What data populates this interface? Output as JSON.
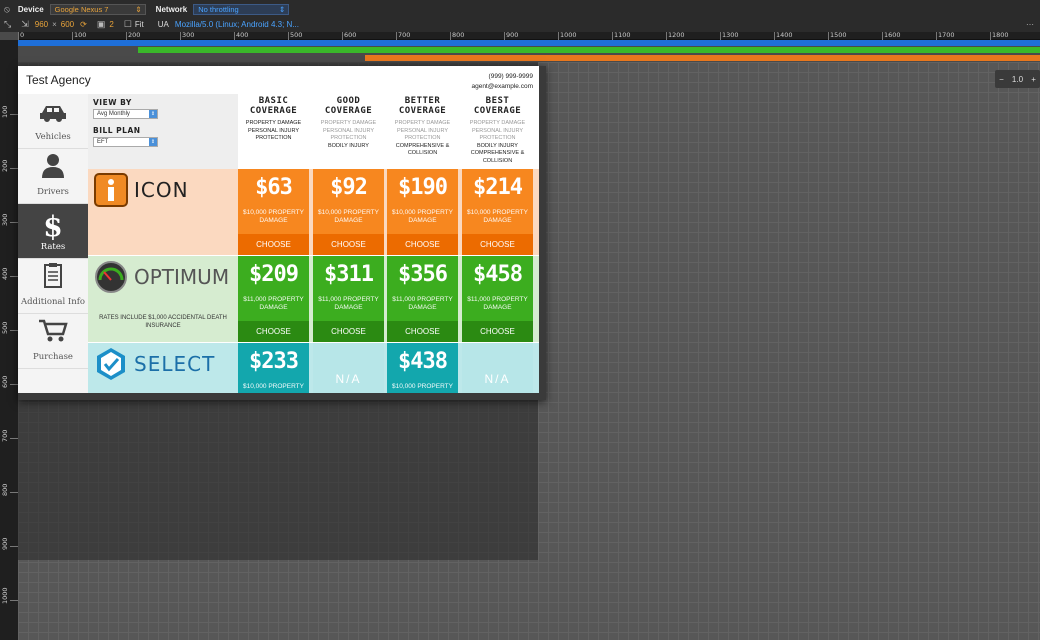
{
  "devtools": {
    "device_label": "Device",
    "device_value": "Google Nexus 7",
    "network_label": "Network",
    "network_value": "No throttling",
    "width": "960",
    "times": "×",
    "height": "600",
    "dpr": "2",
    "fit_label": "Fit",
    "ua_label": "UA",
    "ua_value": "Mozilla/5.0 (Linux; Android 4.3; N...",
    "zoom_value": "1.0",
    "zoom_minus": "−",
    "zoom_plus": "+",
    "ruler_h": [
      "0",
      "100",
      "200",
      "300",
      "400",
      "500",
      "600",
      "700",
      "800",
      "900",
      "1000",
      "1100",
      "1200",
      "1300",
      "1400",
      "1500",
      "1600",
      "1700",
      "1800"
    ],
    "ruler_v": [
      "100",
      "200",
      "300",
      "400",
      "500",
      "600",
      "700",
      "800",
      "900",
      "1000"
    ]
  },
  "app": {
    "agency_name": "Test Agency",
    "phone": "(999) 999-9999",
    "email": "agent@example.com",
    "nav": [
      {
        "label": "Vehicles",
        "icon": "car-icon"
      },
      {
        "label": "Drivers",
        "icon": "person-icon"
      },
      {
        "label": "Rates",
        "icon": "dollar-icon"
      },
      {
        "label": "Additional Info",
        "icon": "clipboard-icon"
      },
      {
        "label": "Purchase",
        "icon": "cart-icon"
      }
    ],
    "controls": {
      "view_by_label": "VIEW BY",
      "view_by_value": "Avg Monthly",
      "bill_plan_label": "BILL PLAN",
      "bill_plan_value": "EFT"
    },
    "coverages": [
      {
        "title1": "BASIC",
        "title2": "COVERAGE",
        "features": [
          "PROPERTY DAMAGE",
          "PERSONAL INJURY",
          "PROTECTION"
        ]
      },
      {
        "title1": "GOOD",
        "title2": "COVERAGE",
        "features": [
          "PROPERTY DAMAGE",
          "PERSONAL INJURY",
          "PROTECTION",
          "BODILY INJURY"
        ]
      },
      {
        "title1": "BETTER",
        "title2": "COVERAGE",
        "features": [
          "PROPERTY DAMAGE",
          "PERSONAL INJURY",
          "PROTECTION",
          "COMPREHENSIVE &",
          "COLLISION"
        ]
      },
      {
        "title1": "BEST",
        "title2": "COVERAGE",
        "features": [
          "PROPERTY DAMAGE",
          "PERSONAL INJURY",
          "PROTECTION",
          "BODILY INJURY",
          "COMPREHENSIVE &",
          "COLLISION"
        ]
      }
    ],
    "carriers": [
      {
        "name": "ICON",
        "logo_letter": "i",
        "note": "",
        "colors": {
          "band": "#fbd9c0",
          "cell": "#f7871f",
          "choose": "#ec6b00"
        },
        "prices": [
          {
            "price": "$63",
            "sub1": "$10,000 PROPERTY",
            "sub2": "DAMAGE",
            "choose": "CHOOSE"
          },
          {
            "price": "$92",
            "sub1": "$10,000 PROPERTY",
            "sub2": "DAMAGE",
            "choose": "CHOOSE"
          },
          {
            "price": "$190",
            "sub1": "$10,000 PROPERTY",
            "sub2": "DAMAGE",
            "choose": "CHOOSE"
          },
          {
            "price": "$214",
            "sub1": "$10,000 PROPERTY",
            "sub2": "DAMAGE",
            "choose": "CHOOSE"
          }
        ]
      },
      {
        "name": "OPTIMUM",
        "logo_letter": "",
        "note": "RATES INCLUDE $1,000 ACCIDENTAL DEATH INSURANCE",
        "colors": {
          "band": "#d6ecd0",
          "cell": "#3cad1f",
          "choose": "#2b8a12"
        },
        "prices": [
          {
            "price": "$209",
            "sub1": "$11,000 PROPERTY",
            "sub2": "DAMAGE",
            "choose": "CHOOSE"
          },
          {
            "price": "$311",
            "sub1": "$11,000 PROPERTY",
            "sub2": "DAMAGE",
            "choose": "CHOOSE"
          },
          {
            "price": "$356",
            "sub1": "$11,000 PROPERTY",
            "sub2": "DAMAGE",
            "choose": "CHOOSE"
          },
          {
            "price": "$458",
            "sub1": "$11,000 PROPERTY",
            "sub2": "DAMAGE",
            "choose": "CHOOSE"
          }
        ]
      },
      {
        "name": "SELECT",
        "logo_letter": "",
        "note": "",
        "colors": {
          "band": "#bde8ea",
          "cell": "#13a7ad",
          "na": "#b7e6e8"
        },
        "prices": [
          {
            "price": "$233",
            "sub1": "$10,000 PROPERTY",
            "sub2": ""
          },
          {
            "na": "N/A"
          },
          {
            "price": "$438",
            "sub1": "$10,000 PROPERTY",
            "sub2": ""
          },
          {
            "na": "N/A"
          }
        ]
      }
    ]
  }
}
